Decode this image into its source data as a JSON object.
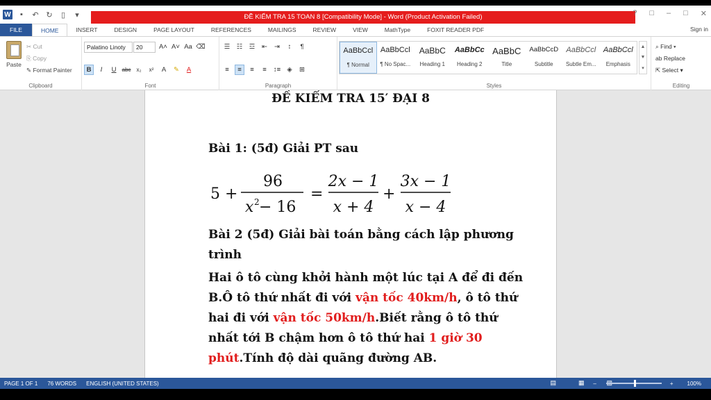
{
  "window": {
    "title": "ĐỀ KIỂM TRA 15 TOAN 8 [Compatibility Mode] -  Word (Product Activation Failed)",
    "controls": [
      "?",
      "□",
      "–",
      "□",
      "✕"
    ]
  },
  "ribbon": {
    "tabs": [
      "FILE",
      "HOME",
      "INSERT",
      "DESIGN",
      "PAGE LAYOUT",
      "REFERENCES",
      "MAILINGS",
      "REVIEW",
      "VIEW",
      "MathType",
      "FOXIT READER PDF"
    ],
    "active_tab": "HOME",
    "signin": "Sign in",
    "clipboard": {
      "paste": "Paste",
      "cut": "Cut",
      "copy": "Copy",
      "format_painter": "Format Painter",
      "label": "Clipboard"
    },
    "font": {
      "name": "Palatino Linoty",
      "size": "20",
      "label": "Font"
    },
    "paragraph": {
      "label": "Paragraph"
    },
    "styles": {
      "label": "Styles",
      "items": [
        {
          "sample": "AaBbCcl",
          "name": "¶ Normal"
        },
        {
          "sample": "AaBbCcl",
          "name": "¶ No Spac..."
        },
        {
          "sample": "AaBbC",
          "name": "Heading 1"
        },
        {
          "sample": "AaBbCc",
          "name": "Heading 2"
        },
        {
          "sample": "AaBbC",
          "name": "Title"
        },
        {
          "sample": "AaBbCcD",
          "name": "Subtitle"
        },
        {
          "sample": "AaBbCcl",
          "name": "Subtle Em..."
        },
        {
          "sample": "AaBbCcl",
          "name": "Emphasis"
        }
      ]
    },
    "editing": {
      "find": "Find",
      "replace": "Replace",
      "select": "Select",
      "label": "Editing"
    }
  },
  "document": {
    "title": "ĐỀ KIỂM TRA 15′ ĐẠI 8",
    "bai1": "Bài 1: (5đ) Giải PT sau",
    "bai2": "Bài 2 (5đ) Giải bài toán bằng cách lập phương trình",
    "problem": {
      "p1": "Hai ô tô cùng khởi hành một lúc tại A để đi đến B.Ô tô thứ nhất đi với ",
      "r1": "vận tốc 40km/h",
      "p2": ", ô tô thứ hai đi với ",
      "r2": "vận tốc 50km/h",
      "p3": ".Biết rằng ô tô thứ nhất tới B chậm hơn ô tô thứ hai ",
      "r3": "1 giờ 30 phút",
      "p4": ".Tính độ dài quãng đường AB."
    },
    "equation": {
      "lead": "5 +",
      "f1_num": "96",
      "f1_den_base": "x",
      "f1_den_exp": "2",
      "f1_den_rest": " − 16",
      "eq": "=",
      "f2_num": "2x − 1",
      "f2_den": "x + 4",
      "plus": "+",
      "f3_num": "3x − 1",
      "f3_den": "x − 4"
    }
  },
  "status": {
    "page": "PAGE 1 OF 1",
    "words": "76 WORDS",
    "language": "ENGLISH (UNITED STATES)",
    "zoom": "100%"
  }
}
